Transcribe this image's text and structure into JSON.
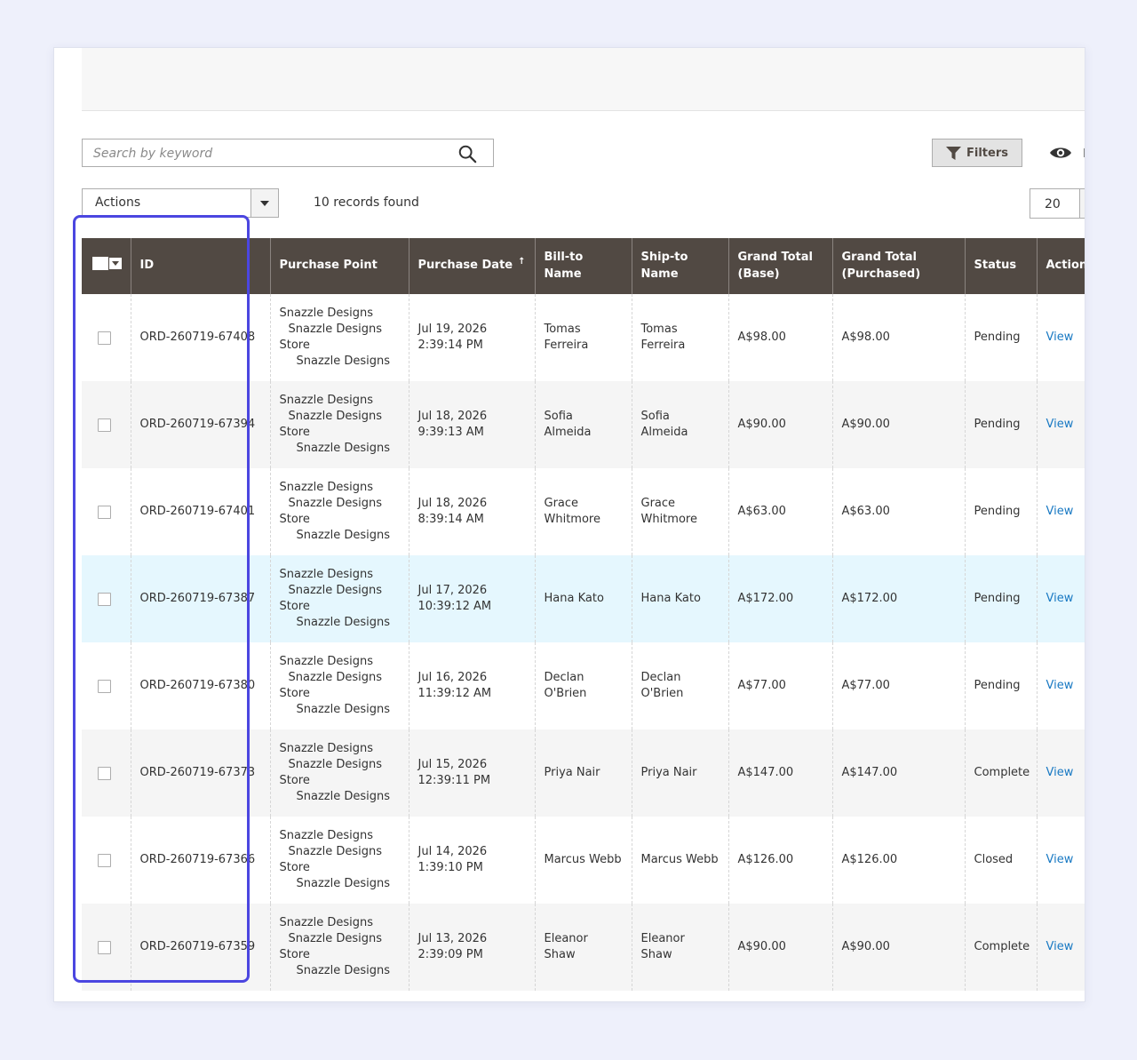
{
  "search": {
    "placeholder": "Search by keyword"
  },
  "toolbar": {
    "filters_label": "Filters",
    "view_label": "D",
    "actions_label": "Actions",
    "records_found": "10 records found",
    "per_page": "20"
  },
  "columns": [
    "ID",
    "Purchase Point",
    "Purchase Date",
    "Bill-to Name",
    "Ship-to Name",
    "Grand Total (Base)",
    "Grand Total (Purchased)",
    "Status",
    "Action"
  ],
  "purchase_point": {
    "l1": "Snazzle Designs",
    "l2": "Snazzle Designs",
    "l3": "Store",
    "l4": "Snazzle Designs"
  },
  "rows": [
    {
      "id": "ORD-260719-67408",
      "date": "Jul 19, 2026 2:39:14 PM",
      "bill": "Tomas Ferreira",
      "ship": "Tomas Ferreira",
      "base": "A$98.00",
      "purchased": "A$98.00",
      "status": "Pending",
      "action": "View"
    },
    {
      "id": "ORD-260719-67394",
      "date": "Jul 18, 2026 9:39:13 AM",
      "bill": "Sofia Almeida",
      "ship": "Sofia Almeida",
      "base": "A$90.00",
      "purchased": "A$90.00",
      "status": "Pending",
      "action": "View"
    },
    {
      "id": "ORD-260719-67401",
      "date": "Jul 18, 2026 8:39:14 AM",
      "bill": "Grace Whitmore",
      "ship": "Grace Whitmore",
      "base": "A$63.00",
      "purchased": "A$63.00",
      "status": "Pending",
      "action": "View"
    },
    {
      "id": "ORD-260719-67387",
      "date": "Jul 17, 2026 10:39:12 AM",
      "bill": "Hana Kato",
      "ship": "Hana Kato",
      "base": "A$172.00",
      "purchased": "A$172.00",
      "status": "Pending",
      "action": "View"
    },
    {
      "id": "ORD-260719-67380",
      "date": "Jul 16, 2026 11:39:12 AM",
      "bill": "Declan O'Brien",
      "ship": "Declan O'Brien",
      "base": "A$77.00",
      "purchased": "A$77.00",
      "status": "Pending",
      "action": "View"
    },
    {
      "id": "ORD-260719-67373",
      "date": "Jul 15, 2026 12:39:11 PM",
      "bill": "Priya Nair",
      "ship": "Priya Nair",
      "base": "A$147.00",
      "purchased": "A$147.00",
      "status": "Complete",
      "action": "View"
    },
    {
      "id": "ORD-260719-67366",
      "date": "Jul 14, 2026 1:39:10 PM",
      "bill": "Marcus Webb",
      "ship": "Marcus Webb",
      "base": "A$126.00",
      "purchased": "A$126.00",
      "status": "Closed",
      "action": "View"
    },
    {
      "id": "ORD-260719-67359",
      "date": "Jul 13, 2026 2:39:09 PM",
      "bill": "Eleanor Shaw",
      "ship": "Eleanor Shaw",
      "base": "A$90.00",
      "purchased": "A$90.00",
      "status": "Complete",
      "action": "View"
    }
  ],
  "colors": {
    "header_bg": "#514943",
    "link": "#1979c3",
    "highlight": "#4b46e0",
    "row_hover": "#e5f7fe"
  }
}
